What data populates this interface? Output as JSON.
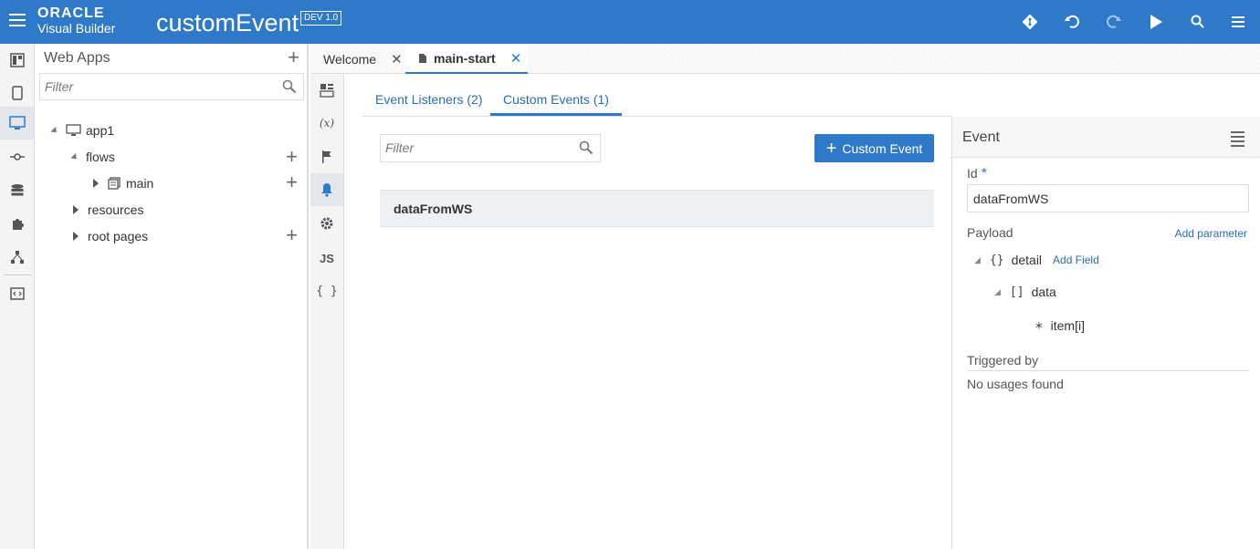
{
  "header": {
    "logo_line1": "ORACLE",
    "logo_line2": "Visual Builder",
    "app_title": "customEvent",
    "badge": "DEV 1.0",
    "icons": [
      "git-icon",
      "undo-icon",
      "redo-icon",
      "run-icon",
      "search-icon",
      "menu-icon"
    ]
  },
  "rail": {
    "items": [
      "web-apps-icon",
      "mobile-apps-icon",
      "desktop-apps-icon",
      "services-icon",
      "business-objects-icon",
      "components-icon",
      "processes-icon",
      "source-icon"
    ]
  },
  "navigator": {
    "title": "Web Apps",
    "filter_placeholder": "Filter",
    "tree": [
      {
        "label": "app1"
      },
      {
        "label": "flows"
      },
      {
        "label": "main"
      },
      {
        "label": "resources"
      },
      {
        "label": "root pages"
      }
    ]
  },
  "tabs": [
    {
      "label": "Welcome",
      "close": "✕"
    },
    {
      "label": "main-start",
      "close": "✕"
    }
  ],
  "rail2": {
    "items": [
      "page-designer-icon",
      "variables-icon",
      "actions-icon",
      "events-icon",
      "settings-icon",
      "JS",
      "{ }"
    ]
  },
  "main": {
    "subtabs": [
      "Event Listeners (2)",
      "Custom Events (1)"
    ],
    "filter_placeholder": "Filter",
    "add_button": "Custom Event",
    "events": [
      "dataFromWS"
    ]
  },
  "props": {
    "title": "Event",
    "id_label": "Id",
    "required_mark": "*",
    "id_value": "dataFromWS",
    "payload_label": "Payload",
    "add_parameter": "Add parameter",
    "tree": {
      "detail_symbol": "{}",
      "detail": "detail",
      "add_field": "Add Field",
      "data_symbol": "[]",
      "data": "data",
      "item_symbol": "∗",
      "item": "item[i]"
    },
    "triggered_by_label": "Triggered by",
    "triggered_by_value": "No usages found"
  }
}
